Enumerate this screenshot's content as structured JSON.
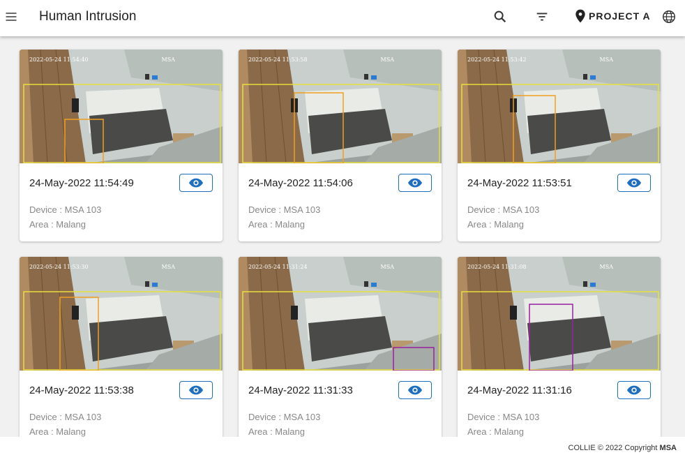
{
  "header": {
    "title": "Human Intrusion",
    "project_label": "PROJECT A",
    "icons": [
      "menu-icon",
      "search-icon",
      "filter-icon",
      "location-pin-icon",
      "globe-icon"
    ]
  },
  "cards": [
    {
      "time": "24-May-2022 11:54:49",
      "device": "Device : MSA 103",
      "area": "Area : Malang",
      "overlay_ts": "2022-05-24 11:54:40",
      "overlay_cam": "MSA"
    },
    {
      "time": "24-May-2022 11:54:06",
      "device": "Device : MSA 103",
      "area": "Area : Malang",
      "overlay_ts": "2022-05-24 11:53:58",
      "overlay_cam": "MSA"
    },
    {
      "time": "24-May-2022 11:53:51",
      "device": "Device : MSA 103",
      "area": "Area : Malang",
      "overlay_ts": "2022-05-24 11:53:42",
      "overlay_cam": "MSA"
    },
    {
      "time": "24-May-2022 11:53:38",
      "device": "Device : MSA 103",
      "area": "Area : Malang",
      "overlay_ts": "2022-05-24 11:53:30",
      "overlay_cam": "MSA"
    },
    {
      "time": "24-May-2022 11:31:33",
      "device": "Device : MSA 103",
      "area": "Area : Malang",
      "overlay_ts": "2022-05-24 11:31:24",
      "overlay_cam": "MSA"
    },
    {
      "time": "24-May-2022 11:31:16",
      "device": "Device : MSA 103",
      "area": "Area : Malang",
      "overlay_ts": "2022-05-24 11:31:08",
      "overlay_cam": "MSA"
    }
  ],
  "footer": {
    "text": "COLLIE © 2022 Copyright",
    "brand": "MSA"
  },
  "colors": {
    "accent": "#1e6fc0",
    "zone_box": "#e8e03a",
    "person_box": "#f0a020",
    "helmet_box": "#9b1fa0"
  }
}
